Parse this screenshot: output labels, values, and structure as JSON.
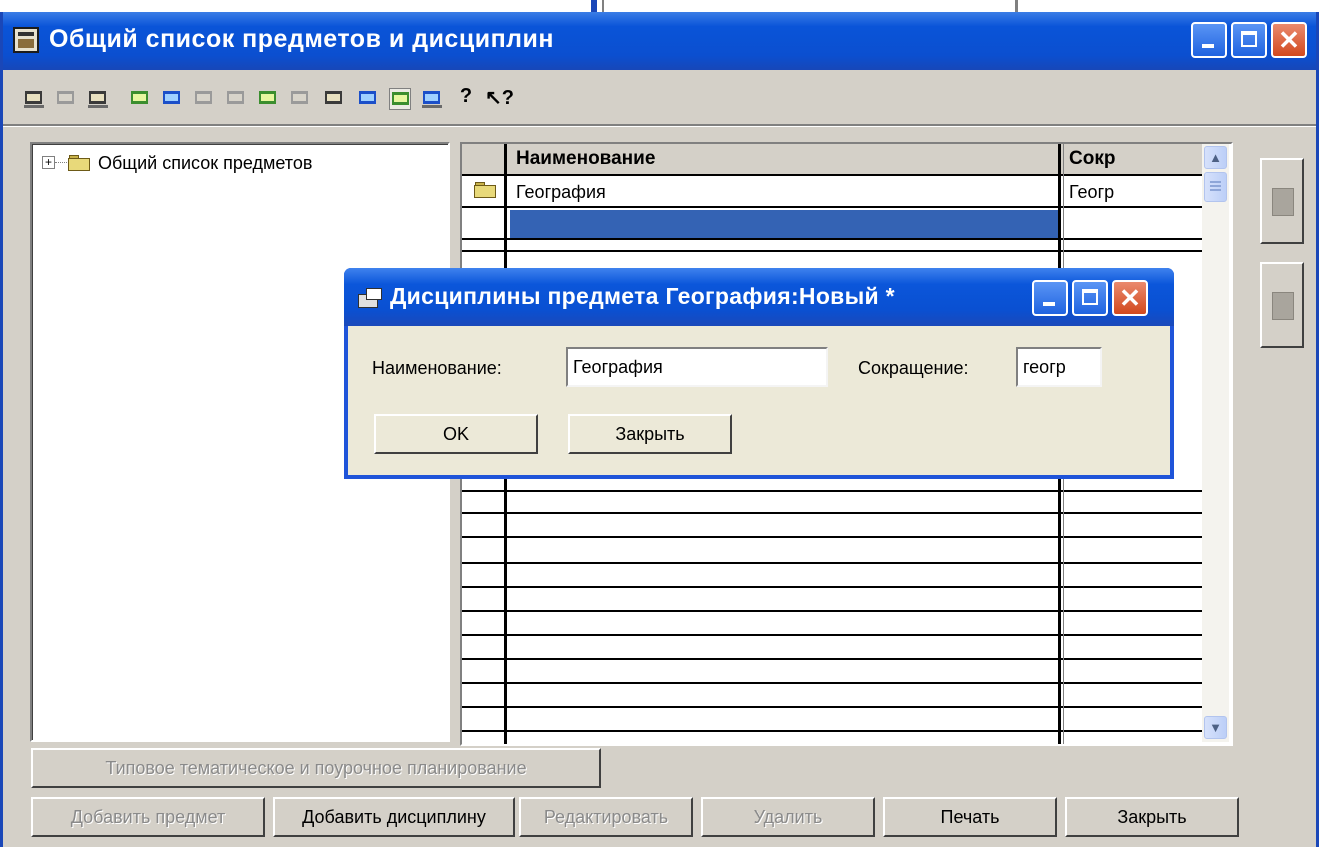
{
  "main_window": {
    "title": "Общий список предметов и дисциплин",
    "title_bar_color": "#0a54d8",
    "controls": {
      "minimize_icon": "minimize-icon",
      "maximize_icon": "maximize-icon",
      "close_glyph": "✕"
    }
  },
  "toolbar": {
    "icons": [
      "new-icon",
      "folder-icon",
      "properties-icon",
      "find-icon",
      "add-row-icon",
      "delete-row-icon",
      "edit-row-icon",
      "mark-icon",
      "copy-icon",
      "document-icon",
      "table-icon",
      "tree-icon",
      "export-icon",
      "help-icon",
      "context-help-icon"
    ],
    "help_glyph": "?",
    "context_help_glyph": "↖?"
  },
  "tree": {
    "root": {
      "expander": "+",
      "label": "Общий список предметов"
    }
  },
  "grid": {
    "columns": [
      "Наименование",
      "Сокр"
    ],
    "rows": [
      {
        "name": "География",
        "abbr": "Геогр"
      },
      {
        "name": "",
        "abbr": ""
      }
    ],
    "scroll_up_glyph": "▲",
    "scroll_down_glyph": "▼",
    "selection_color": "#3463b4"
  },
  "buttons": {
    "planning": "Типовое тематическое и поурочное планирование",
    "add_subject": "Добавить предмет",
    "add_discipline": "Добавить дисциплину",
    "edit": "Редактировать",
    "delete": "Удалить",
    "print": "Печать",
    "close": "Закрыть"
  },
  "dialog": {
    "title": "Дисциплины предмета География:Новый *",
    "name_label": "Наименование:",
    "name_value": "География",
    "abbr_label": "Сокращение:",
    "abbr_value": "геогр",
    "ok": "OK",
    "close": "Закрыть",
    "close_glyph": "✕"
  }
}
